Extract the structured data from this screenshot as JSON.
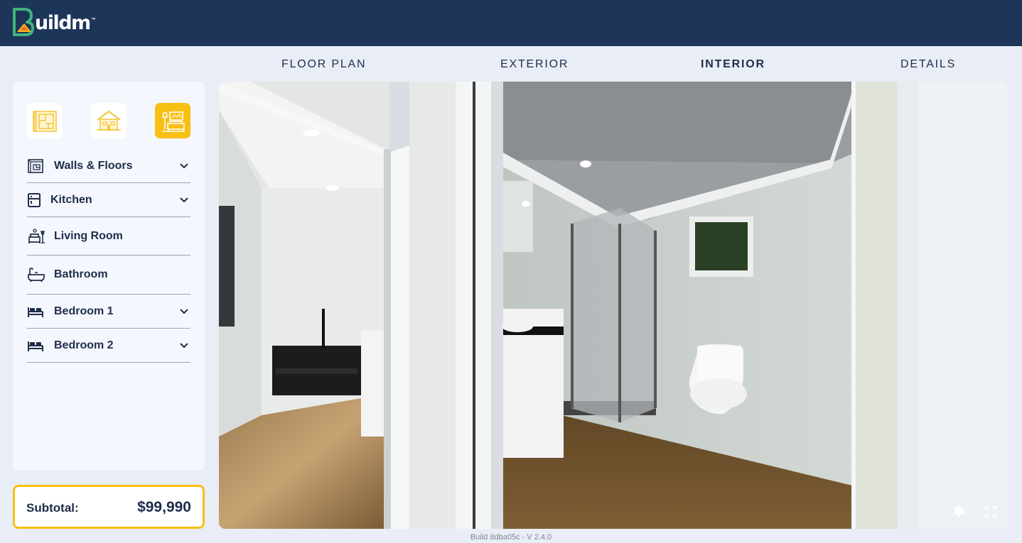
{
  "header": {
    "logo_text": "uildm",
    "logo_tm": "™"
  },
  "tabs": [
    {
      "label": "FLOOR PLAN",
      "active": false
    },
    {
      "label": "EXTERIOR",
      "active": false
    },
    {
      "label": "INTERIOR",
      "active": true
    },
    {
      "label": "DETAILS",
      "active": false
    }
  ],
  "sidebar": {
    "modes": [
      {
        "name": "floorplan-mode",
        "icon": "blueprint-icon",
        "active": false
      },
      {
        "name": "exterior-mode",
        "icon": "house-icon",
        "active": false
      },
      {
        "name": "interior-mode",
        "icon": "living-room-icon",
        "active": true
      }
    ],
    "items": [
      {
        "label": "Walls & Floors",
        "icon": "walls-floors-icon",
        "expandable": true
      },
      {
        "label": "Kitchen",
        "icon": "kitchen-icon",
        "expandable": true
      },
      {
        "label": "Living Room",
        "icon": "living-room-icon",
        "expandable": false
      },
      {
        "label": "Bathroom",
        "icon": "bathtub-icon",
        "expandable": false
      },
      {
        "label": "Bedroom 1",
        "icon": "bed-icon",
        "expandable": true
      },
      {
        "label": "Bedroom 2",
        "icon": "bed-icon",
        "expandable": true
      }
    ]
  },
  "subtotal": {
    "label": "Subtotal:",
    "value": "$99,990"
  },
  "viewer": {
    "controls": [
      "settings-icon",
      "fullscreen-icon"
    ]
  },
  "footer": {
    "build": "Build 8dba05c - V 2.4.0"
  },
  "colors": {
    "header": "#1e355a",
    "accent": "#f8bf14",
    "background": "#e9edf5",
    "text": "#1f2d4a"
  }
}
